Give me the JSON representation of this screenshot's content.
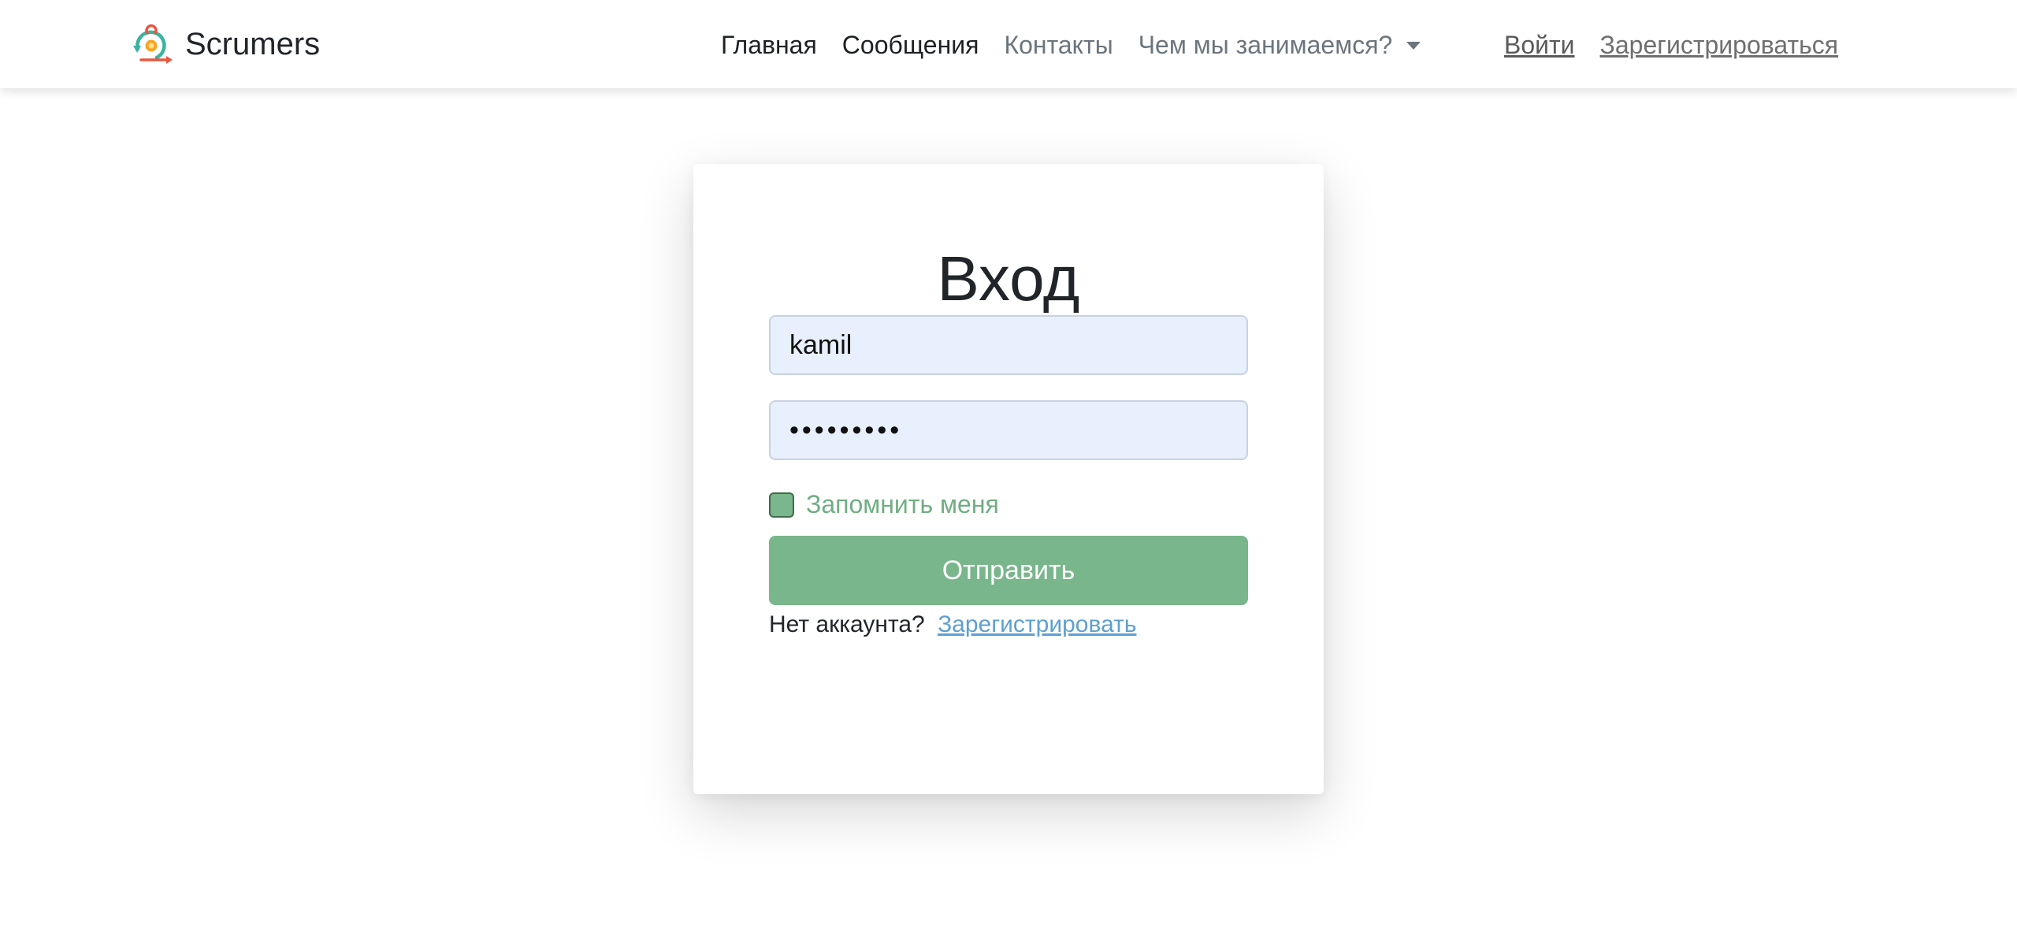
{
  "brand": {
    "name": "Scrumers",
    "logo_icon": "scrum-cycle-icon"
  },
  "nav": {
    "items": [
      {
        "label": "Главная"
      },
      {
        "label": "Сообщения"
      },
      {
        "label": "Контакты"
      },
      {
        "label": "Чем мы занимаемся?"
      }
    ],
    "dropdown_icon": "caret-down-icon"
  },
  "auth": {
    "login_label": "Войти",
    "register_label": "Зарегистрироваться"
  },
  "login_form": {
    "title": "Вход",
    "username_value": "kamil",
    "password_value": "•••••••••",
    "remember_label": "Запомнить меня",
    "remember_checked": true,
    "submit_label": "Отправить",
    "no_account_text": "Нет аккаунта?",
    "register_link": "Зарегистрировать"
  },
  "colors": {
    "accent_green": "#79b68b",
    "link_blue": "#5e9fd0",
    "input_bg": "#e8f0fe"
  }
}
